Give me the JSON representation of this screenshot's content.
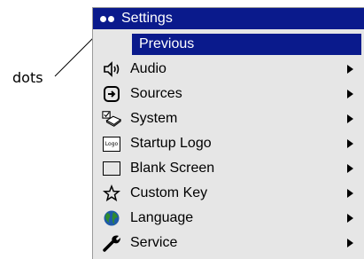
{
  "callout": {
    "label": "dots"
  },
  "menu": {
    "title": "Settings",
    "previous_label": "Previous",
    "items": [
      {
        "label": "Audio",
        "icon": "speaker-icon"
      },
      {
        "label": "Sources",
        "icon": "source-icon"
      },
      {
        "label": "System",
        "icon": "system-icon"
      },
      {
        "label": "Startup Logo",
        "icon": "logo-icon",
        "icon_text": "Logo"
      },
      {
        "label": "Blank Screen",
        "icon": "blank-screen-icon"
      },
      {
        "label": "Custom Key",
        "icon": "star-icon"
      },
      {
        "label": "Language",
        "icon": "globe-icon"
      },
      {
        "label": "Service",
        "icon": "wrench-icon"
      }
    ]
  },
  "colors": {
    "header_bg": "#0a1a8c",
    "menu_bg": "#e6e6e6",
    "globe_green": "#2e8b2e",
    "globe_blue": "#1e5aa8"
  }
}
